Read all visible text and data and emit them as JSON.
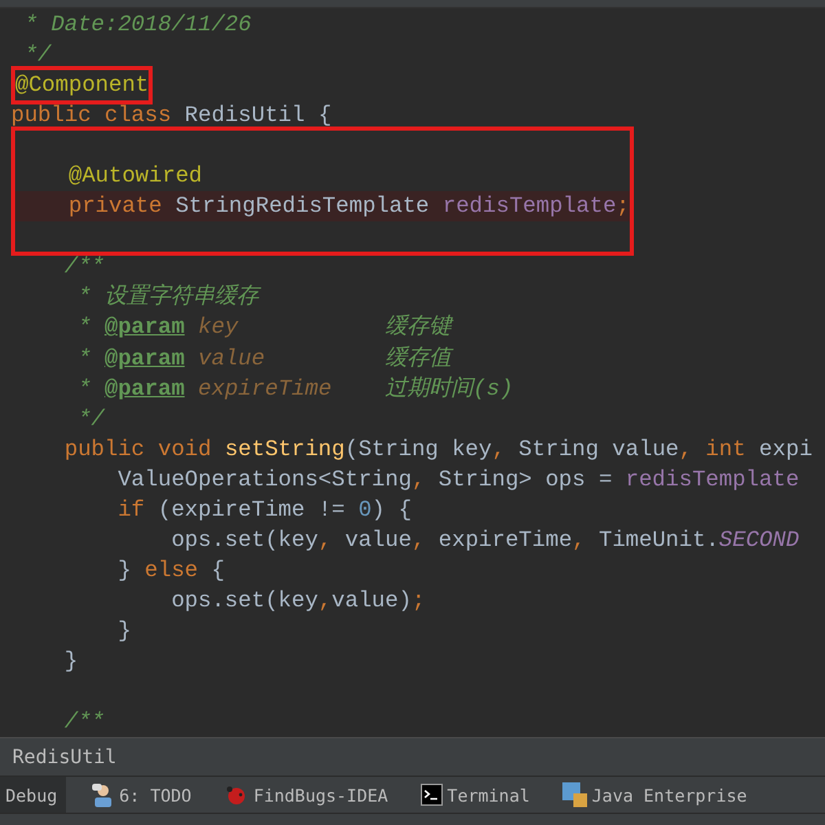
{
  "code": {
    "blocks": [
      {
        "lines": [
          {
            "kind": "code",
            "tokens": [
              {
                "kind": "comment",
                "text": " * Date:2018/11/26"
              }
            ]
          },
          {
            "kind": "code",
            "tokens": [
              {
                "kind": "comment",
                "text": " */"
              }
            ]
          }
        ]
      },
      {
        "marked": true,
        "lines": [
          {
            "kind": "code",
            "tokens": [
              {
                "kind": "annotation",
                "text": "@Component"
              }
            ]
          }
        ]
      },
      {
        "lines": [
          {
            "kind": "code",
            "tokens": [
              {
                "kind": "keyword",
                "text": "public class "
              },
              {
                "kind": "plain",
                "text": "RedisUtil {"
              }
            ]
          }
        ]
      },
      {
        "marked": true,
        "lines": [
          {
            "kind": "blank"
          },
          {
            "kind": "code",
            "tokens": [
              {
                "kind": "annotation",
                "text": "    @Autowired"
              }
            ]
          },
          {
            "kind": "code",
            "highlighted": true,
            "tokens": [
              {
                "kind": "keyword",
                "text": "    private "
              },
              {
                "kind": "plain",
                "text": "StringRedisTemplate "
              },
              {
                "kind": "field",
                "text": "redisTemplate"
              },
              {
                "kind": "keyword",
                "text": ";"
              }
            ]
          },
          {
            "kind": "blank"
          }
        ]
      },
      {
        "lines": [
          {
            "kind": "code",
            "tokens": [
              {
                "kind": "comment",
                "text": "    /**"
              }
            ]
          },
          {
            "kind": "code",
            "tokens": [
              {
                "kind": "comment",
                "text": "     * 设置字符串缓存"
              }
            ]
          },
          {
            "kind": "code",
            "tokens": [
              {
                "kind": "comment",
                "text": "     * "
              },
              {
                "kind": "doctag",
                "text": "@param"
              },
              {
                "kind": "docparam",
                "text": " key"
              },
              {
                "kind": "comment",
                "text": "           缓存键"
              }
            ]
          },
          {
            "kind": "code",
            "tokens": [
              {
                "kind": "comment",
                "text": "     * "
              },
              {
                "kind": "doctag",
                "text": "@param"
              },
              {
                "kind": "docparam",
                "text": " value"
              },
              {
                "kind": "comment",
                "text": "         缓存值"
              }
            ]
          },
          {
            "kind": "code",
            "tokens": [
              {
                "kind": "comment",
                "text": "     * "
              },
              {
                "kind": "doctag",
                "text": "@param"
              },
              {
                "kind": "docparam",
                "text": " expireTime"
              },
              {
                "kind": "comment",
                "text": "    过期时间(s)"
              }
            ]
          },
          {
            "kind": "code",
            "tokens": [
              {
                "kind": "comment",
                "text": "     */"
              }
            ]
          },
          {
            "kind": "code",
            "tokens": [
              {
                "kind": "keyword",
                "text": "    public void "
              },
              {
                "kind": "method",
                "text": "setString"
              },
              {
                "kind": "plain",
                "text": "(String key"
              },
              {
                "kind": "keyword",
                "text": ", "
              },
              {
                "kind": "plain",
                "text": "String value"
              },
              {
                "kind": "keyword",
                "text": ", int "
              },
              {
                "kind": "plain",
                "text": "expi"
              }
            ]
          },
          {
            "kind": "code",
            "tokens": [
              {
                "kind": "plain",
                "text": "        ValueOperations<String"
              },
              {
                "kind": "keyword",
                "text": ", "
              },
              {
                "kind": "plain",
                "text": "String> ops = "
              },
              {
                "kind": "field",
                "text": "redisTemplate"
              }
            ]
          },
          {
            "kind": "code",
            "tokens": [
              {
                "kind": "keyword",
                "text": "        if "
              },
              {
                "kind": "plain",
                "text": "(expireTime != "
              },
              {
                "kind": "number",
                "text": "0"
              },
              {
                "kind": "plain",
                "text": ") {"
              }
            ]
          },
          {
            "kind": "code",
            "tokens": [
              {
                "kind": "plain",
                "text": "            ops.set(key"
              },
              {
                "kind": "keyword",
                "text": ", "
              },
              {
                "kind": "plain",
                "text": "value"
              },
              {
                "kind": "keyword",
                "text": ", "
              },
              {
                "kind": "plain",
                "text": "expireTime"
              },
              {
                "kind": "keyword",
                "text": ", "
              },
              {
                "kind": "plain",
                "text": "TimeUnit."
              },
              {
                "kind": "static",
                "text": "SECOND"
              }
            ]
          },
          {
            "kind": "code",
            "tokens": [
              {
                "kind": "plain",
                "text": "        } "
              },
              {
                "kind": "keyword",
                "text": "else "
              },
              {
                "kind": "plain",
                "text": "{"
              }
            ]
          },
          {
            "kind": "code",
            "tokens": [
              {
                "kind": "plain",
                "text": "            ops.set(key"
              },
              {
                "kind": "keyword",
                "text": ","
              },
              {
                "kind": "plain",
                "text": "value)"
              },
              {
                "kind": "keyword",
                "text": ";"
              }
            ]
          },
          {
            "kind": "code",
            "tokens": [
              {
                "kind": "plain",
                "text": "        }"
              }
            ]
          },
          {
            "kind": "code",
            "tokens": [
              {
                "kind": "plain",
                "text": "    }"
              }
            ]
          },
          {
            "kind": "blank"
          },
          {
            "kind": "code",
            "tokens": [
              {
                "kind": "comment",
                "text": "    /**"
              }
            ]
          }
        ]
      }
    ]
  },
  "breadcrumb": "RedisUtil",
  "tool_windows": [
    {
      "label": "Debug",
      "selected": true,
      "kind": "plain"
    },
    {
      "label": "6: TODO",
      "selected": false,
      "kind": "todo"
    },
    {
      "label": "FindBugs-IDEA",
      "selected": false,
      "kind": "bug"
    },
    {
      "label": "Terminal",
      "selected": false,
      "kind": "terminal"
    },
    {
      "label": "Java Enterprise",
      "selected": false,
      "kind": "enterprise"
    }
  ]
}
